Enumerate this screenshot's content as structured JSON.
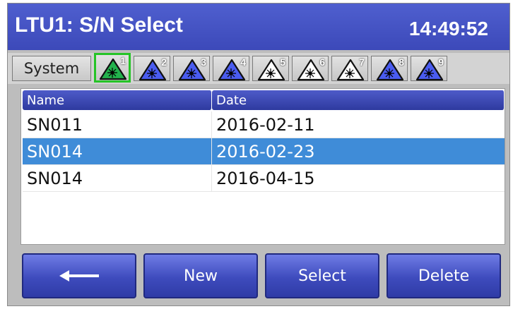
{
  "header": {
    "title": "LTU1: S/N Select",
    "time": "14:49:52"
  },
  "tabs": {
    "system_label": "System",
    "laser_tabs": [
      {
        "num": "1",
        "color": "#22b14c",
        "active": true
      },
      {
        "num": "2",
        "color": "#4a5cf0",
        "active": false
      },
      {
        "num": "3",
        "color": "#4a5cf0",
        "active": false
      },
      {
        "num": "4",
        "color": "#4a5cf0",
        "active": false
      },
      {
        "num": "5",
        "color": "#ffffff",
        "active": false
      },
      {
        "num": "6",
        "color": "#ffffff",
        "active": false
      },
      {
        "num": "7",
        "color": "#ffffff",
        "active": false
      },
      {
        "num": "8",
        "color": "#4a5cf0",
        "active": false
      },
      {
        "num": "9",
        "color": "#4a5cf0",
        "active": false
      }
    ]
  },
  "table": {
    "columns": [
      "Name",
      "Date"
    ],
    "rows": [
      {
        "name": "SN011",
        "date": "2016-02-11",
        "selected": false
      },
      {
        "name": "SN014",
        "date": "2016-02-23",
        "selected": true
      },
      {
        "name": "SN014",
        "date": "2016-04-15",
        "selected": false
      }
    ]
  },
  "buttons": {
    "back_icon": "left-arrow-icon",
    "new": "New",
    "select": "Select",
    "delete": "Delete"
  },
  "colors": {
    "accent": "#3c49b9",
    "selection": "#3f8cd8",
    "active_tab_border": "#25c426"
  }
}
